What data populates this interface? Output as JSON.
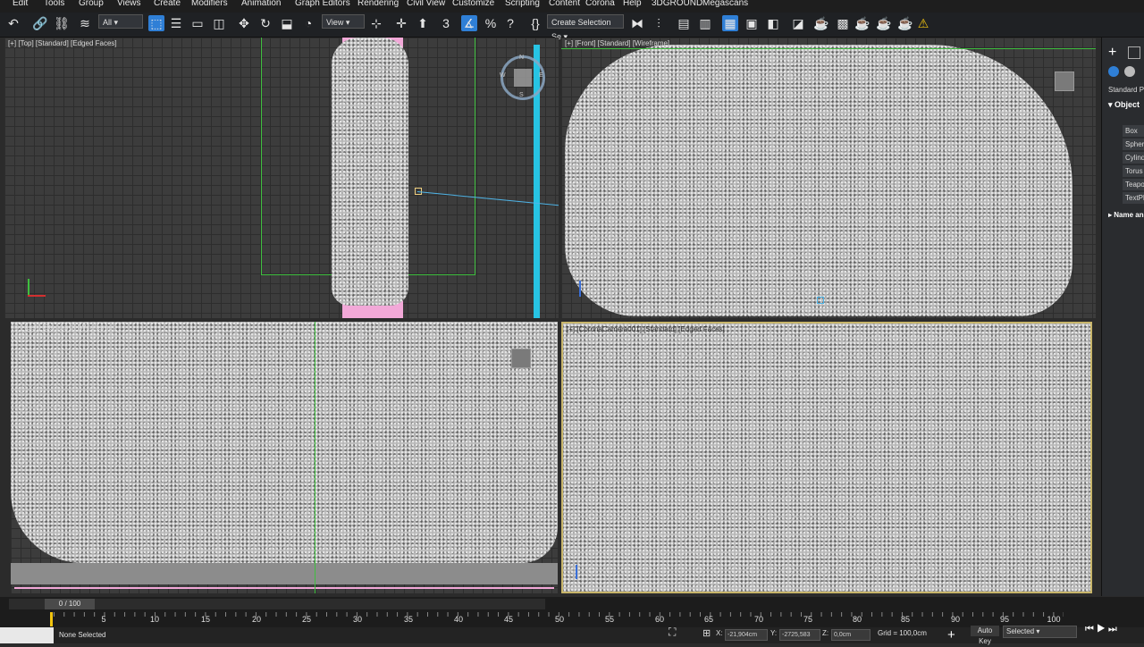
{
  "menu": [
    "Edit",
    "Tools",
    "Group",
    "Views",
    "Create",
    "Modifiers",
    "Animation",
    "Graph Editors",
    "Rendering",
    "Civil View",
    "Customize",
    "Scripting",
    "Content",
    "Corona",
    "Help",
    "3DGROUND",
    "Megascans"
  ],
  "toolbar": {
    "filter_dropdown": "All",
    "reference_dropdown": "View",
    "selection_set": "Create Selection Se"
  },
  "viewports": [
    {
      "label": "[+] [Top] [Standard] [Edged Faces]"
    },
    {
      "label": "[+] [Front] [Standard] [Wireframe]"
    },
    {
      "label": "[+] [Left] [Standard] [Wireframe]"
    },
    {
      "label": "[+] [CoronaCamera001] [Standard] [Edged Faces]"
    }
  ],
  "viewcube": {
    "n": "N",
    "s": "S",
    "e": "E",
    "w": "W"
  },
  "command_panel": {
    "dropdown": "Standard Pr",
    "rollout_object_type": "Object",
    "items": [
      "Box",
      "Spher",
      "Cylind",
      "Torus",
      "Teapo",
      "TextPl"
    ],
    "rollout_name": "Name an"
  },
  "timeline": {
    "frame_counter": "0 / 100",
    "ticks": [
      "5",
      "10",
      "15",
      "20",
      "25",
      "30",
      "35",
      "40",
      "45",
      "50",
      "55",
      "60",
      "65",
      "70",
      "75",
      "80",
      "85",
      "90",
      "95",
      "100"
    ]
  },
  "status": {
    "selection": "None Selected",
    "x_label": "X:",
    "x_value": "-21,904cm",
    "y_label": "Y:",
    "y_value": "-2725,583",
    "z_label": "Z:",
    "z_value": "0,0cm",
    "grid": "Grid = 100,0cm",
    "autokey": "Auto Key",
    "selected": "Selected"
  },
  "colors": {
    "accent_blue": "#2f7fd6",
    "selection_pink": "#f2a8d8",
    "cyan_object": "#27c4e4",
    "green_camera": "#3fbf3f",
    "warning_yellow": "#f1c40f"
  }
}
